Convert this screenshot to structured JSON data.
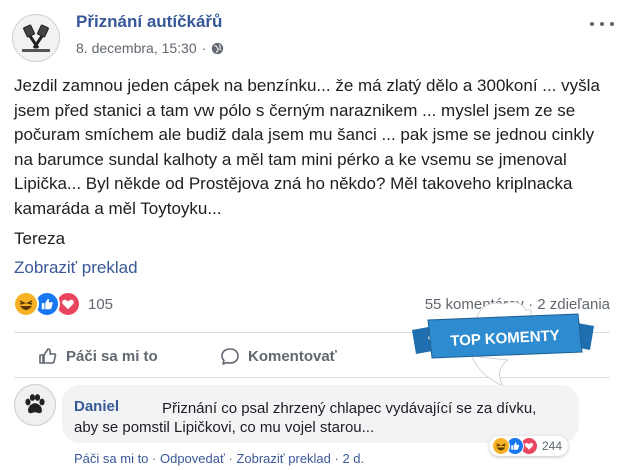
{
  "post": {
    "page_name": "Přiznání autíčkářů",
    "date": "8. decembra, 15:30",
    "text": "Jezdil zamnou jeden cápek na benzínku... že má zlatý dělo a 300koní ... vyšla jsem před stanici a tam vw pólo s černým naraznikem ... myslel jsem ze se počuram smíchem ale budiž dala jsem mu šanci ... pak jsme se jednou cinkly na barumce sundal kalhoty a měl tam mini pérko a ke vsemu se jmenoval Lipička... Byl někde od Prostějova zná ho někdo? Měl takoveho kriplnacka kamaráda a měl Toytoyku...",
    "signature": "Tereza",
    "translate_link": "Zobraziť preklad",
    "reaction_count": "105",
    "stats": "55 komentárov · 2 zdieľania"
  },
  "actions": {
    "like": "Páči sa mi to",
    "comment": "Komentovať"
  },
  "badge": {
    "label": "TOP KOMENTY"
  },
  "comment": {
    "author": "Daniel",
    "line1": "Přiznání co psal zhrzený chlapec vydávající se za dívku,",
    "line2": "aby se pomstil Lipičkovi, co mu vojel starou...",
    "reaction_count": "244",
    "actions": {
      "like": "Páči sa mi to",
      "sep1": " · ",
      "reply": "Odpovedať",
      "sep2": " · ",
      "translate": "Zobraziť preklad",
      "sep3": " · ",
      "time": "2 d."
    }
  },
  "colors": {
    "link": "#385898",
    "page_name": "#365899",
    "secondary_text": "#606770",
    "badge_blue": "#2e8bd0",
    "like_blue": "#1877f2",
    "haha_yellow": "#f7b125",
    "love_red": "#e9455f"
  }
}
